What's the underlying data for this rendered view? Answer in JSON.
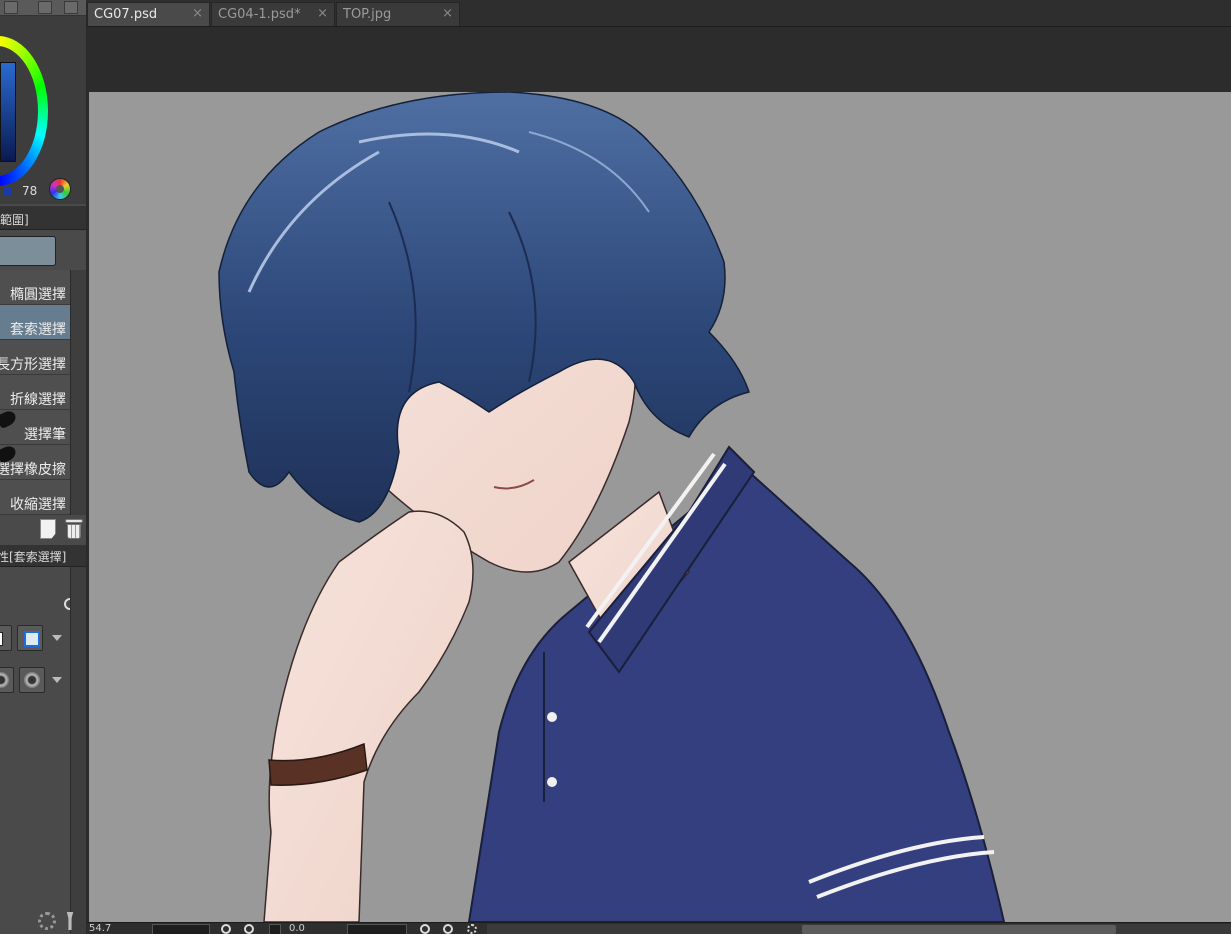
{
  "colors": {
    "accent_selected_tool": "#667d90",
    "canvas_background": "#999999",
    "shirt": "#343f7f",
    "hair": "#2e4a7c"
  },
  "color_panel": {
    "value": "78",
    "icons": [
      "color-wheel-icon",
      "color-mode-icon"
    ]
  },
  "tool_palette": {
    "header": "範圍]",
    "items": [
      {
        "label": "橢圓選擇",
        "selected": false,
        "icon": null
      },
      {
        "label": "套索選擇",
        "selected": true,
        "icon": null
      },
      {
        "label": "長方形選擇",
        "selected": false,
        "icon": null
      },
      {
        "label": "折線選擇",
        "selected": false,
        "icon": null
      },
      {
        "label": "選擇筆",
        "selected": false,
        "icon": "brush-icon"
      },
      {
        "label": "選擇橡皮擦",
        "selected": false,
        "icon": "brush-icon"
      },
      {
        "label": "收縮選擇",
        "selected": false,
        "icon": null
      }
    ]
  },
  "tool_property": {
    "header": "性[套索選擇]"
  },
  "tabs": [
    {
      "label": "CG07.psd",
      "active": true,
      "close": "×"
    },
    {
      "label": "CG04-1.psd*",
      "active": false,
      "close": "×"
    },
    {
      "label": "TOP.jpg",
      "active": false,
      "close": "×"
    }
  ],
  "status_bar": {
    "zoom": "54.7",
    "rotation": "0.0"
  }
}
